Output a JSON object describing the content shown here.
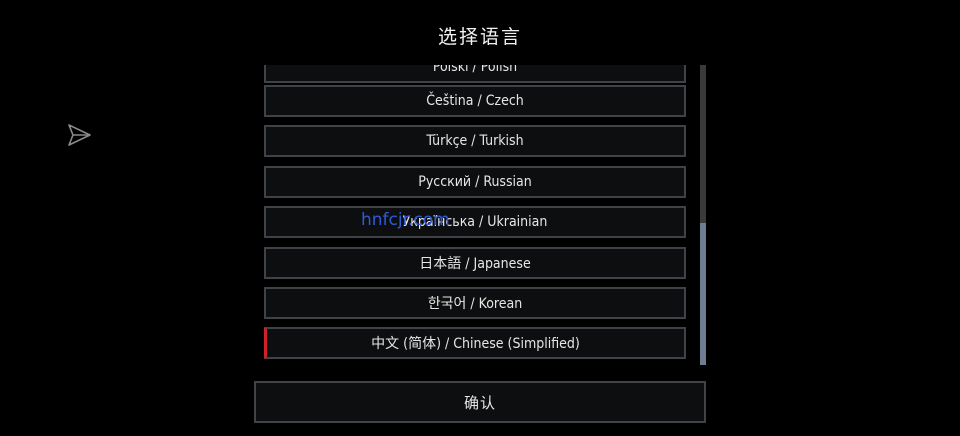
{
  "header": {
    "title": "选择语言"
  },
  "side_icon": {
    "name": "send-icon"
  },
  "languages": [
    {
      "label": "Polski / Polish",
      "selected": false
    },
    {
      "label": "Čeština / Czech",
      "selected": false
    },
    {
      "label": "Türkçe / Turkish",
      "selected": false
    },
    {
      "label": "Русский / Russian",
      "selected": false
    },
    {
      "label": "Українська / Ukrainian",
      "selected": false
    },
    {
      "label": "日本語 / Japanese",
      "selected": false
    },
    {
      "label": "한국어 / Korean",
      "selected": false
    },
    {
      "label": "中文 (简体) / Chinese (Simplified)",
      "selected": true
    }
  ],
  "footer": {
    "confirm_label": "确认"
  },
  "watermark": {
    "text": "hnfcjr.com"
  },
  "colors": {
    "background": "#000000",
    "item_border": "#3f4247",
    "selected_accent": "#d0202a",
    "scroll_thumb": "#6e7d92",
    "watermark": "#2f5bd8"
  }
}
